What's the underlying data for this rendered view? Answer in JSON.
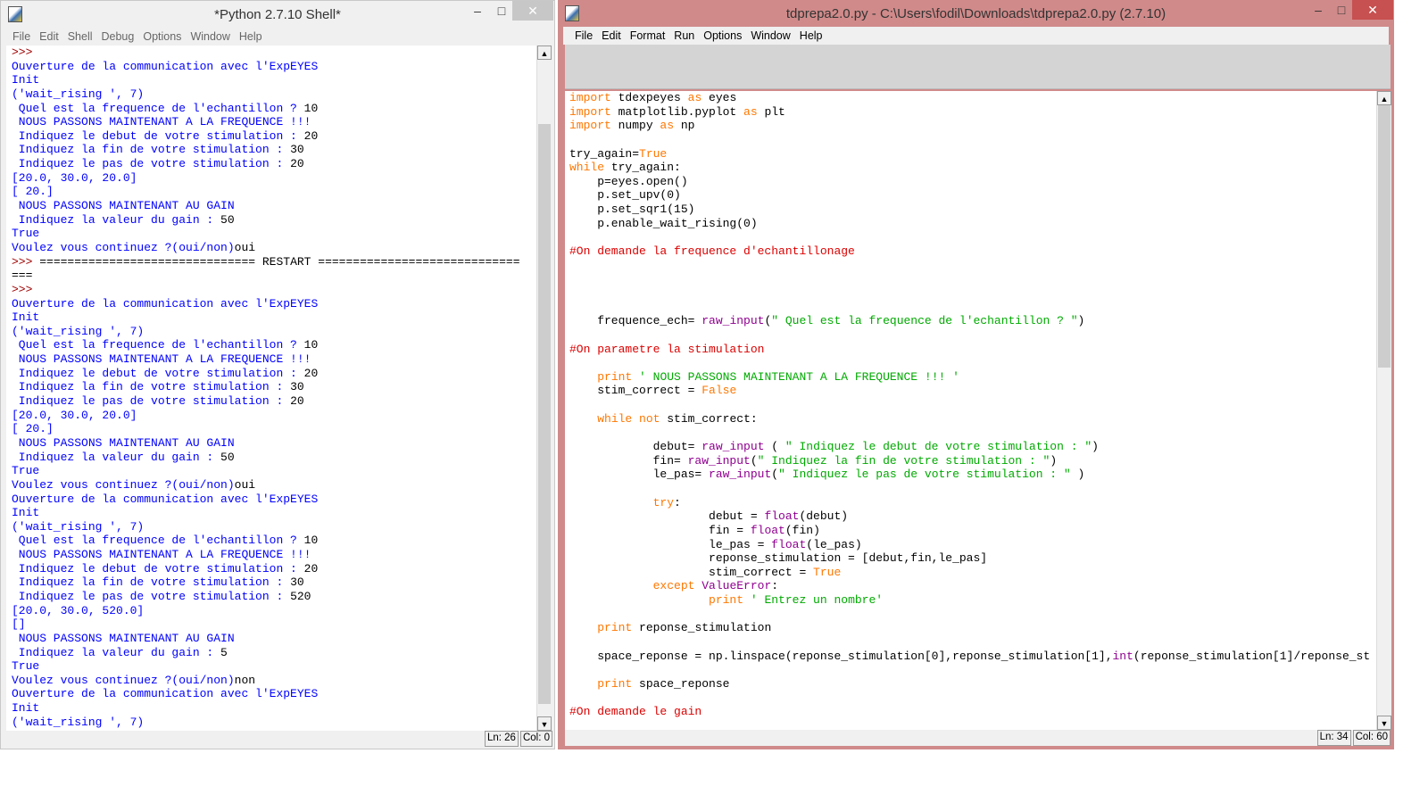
{
  "shell": {
    "title": "*Python 2.7.10 Shell*",
    "menu": [
      "File",
      "Edit",
      "Shell",
      "Debug",
      "Options",
      "Window",
      "Help"
    ],
    "status": {
      "ln": "Ln: 26",
      "col": "Col: 0"
    },
    "lines": [
      [
        [
          ">>> ",
          "pr"
        ]
      ],
      [
        [
          "Ouverture de la communication avec l'ExpEYES",
          "out"
        ]
      ],
      [
        [
          "Init",
          "out"
        ]
      ],
      [
        [
          "('wait_rising ', 7)",
          "out"
        ]
      ],
      [
        [
          " Quel est la frequence de l'echantillon ? ",
          "out"
        ],
        [
          "10",
          "in"
        ]
      ],
      [
        [
          " NOUS PASSONS MAINTENANT A LA FREQUENCE !!!",
          "out"
        ]
      ],
      [
        [
          " Indiquez le debut de votre stimulation : ",
          "out"
        ],
        [
          "20",
          "in"
        ]
      ],
      [
        [
          " Indiquez la fin de votre stimulation : ",
          "out"
        ],
        [
          "30",
          "in"
        ]
      ],
      [
        [
          " Indiquez le pas de votre stimulation : ",
          "out"
        ],
        [
          "20",
          "in"
        ]
      ],
      [
        [
          "[20.0, 30.0, 20.0]",
          "out"
        ]
      ],
      [
        [
          "[ 20.]",
          "out"
        ]
      ],
      [
        [
          " NOUS PASSONS MAINTENANT AU GAIN",
          "out"
        ]
      ],
      [
        [
          " Indiquez la valeur du gain : ",
          "out"
        ],
        [
          "50",
          "in"
        ]
      ],
      [
        [
          "True",
          "out"
        ]
      ],
      [
        [
          "Voulez vous continuez ?(oui/non)",
          "out"
        ],
        [
          "oui",
          "in"
        ]
      ],
      [
        [
          ">>> ",
          "pr"
        ],
        [
          "=============================== RESTART =============================",
          "in"
        ]
      ],
      [
        [
          "===",
          "in"
        ]
      ],
      [
        [
          ">>> ",
          "pr"
        ]
      ],
      [
        [
          "Ouverture de la communication avec l'ExpEYES",
          "out"
        ]
      ],
      [
        [
          "Init",
          "out"
        ]
      ],
      [
        [
          "('wait_rising ', 7)",
          "out"
        ]
      ],
      [
        [
          " Quel est la frequence de l'echantillon ? ",
          "out"
        ],
        [
          "10",
          "in"
        ]
      ],
      [
        [
          " NOUS PASSONS MAINTENANT A LA FREQUENCE !!!",
          "out"
        ]
      ],
      [
        [
          " Indiquez le debut de votre stimulation : ",
          "out"
        ],
        [
          "20",
          "in"
        ]
      ],
      [
        [
          " Indiquez la fin de votre stimulation : ",
          "out"
        ],
        [
          "30",
          "in"
        ]
      ],
      [
        [
          " Indiquez le pas de votre stimulation : ",
          "out"
        ],
        [
          "20",
          "in"
        ]
      ],
      [
        [
          "[20.0, 30.0, 20.0]",
          "out"
        ]
      ],
      [
        [
          "[ 20.]",
          "out"
        ]
      ],
      [
        [
          " NOUS PASSONS MAINTENANT AU GAIN",
          "out"
        ]
      ],
      [
        [
          " Indiquez la valeur du gain : ",
          "out"
        ],
        [
          "50",
          "in"
        ]
      ],
      [
        [
          "True",
          "out"
        ]
      ],
      [
        [
          "Voulez vous continuez ?(oui/non)",
          "out"
        ],
        [
          "oui",
          "in"
        ]
      ],
      [
        [
          "Ouverture de la communication avec l'ExpEYES",
          "out"
        ]
      ],
      [
        [
          "Init",
          "out"
        ]
      ],
      [
        [
          "('wait_rising ', 7)",
          "out"
        ]
      ],
      [
        [
          " Quel est la frequence de l'echantillon ? ",
          "out"
        ],
        [
          "10",
          "in"
        ]
      ],
      [
        [
          " NOUS PASSONS MAINTENANT A LA FREQUENCE !!!",
          "out"
        ]
      ],
      [
        [
          " Indiquez le debut de votre stimulation : ",
          "out"
        ],
        [
          "20",
          "in"
        ]
      ],
      [
        [
          " Indiquez la fin de votre stimulation : ",
          "out"
        ],
        [
          "30",
          "in"
        ]
      ],
      [
        [
          " Indiquez le pas de votre stimulation : ",
          "out"
        ],
        [
          "520",
          "in"
        ]
      ],
      [
        [
          "[20.0, 30.0, 520.0]",
          "out"
        ]
      ],
      [
        [
          "[]",
          "out"
        ]
      ],
      [
        [
          " NOUS PASSONS MAINTENANT AU GAIN",
          "out"
        ]
      ],
      [
        [
          " Indiquez la valeur du gain : ",
          "out"
        ],
        [
          "5",
          "in"
        ]
      ],
      [
        [
          "True",
          "out"
        ]
      ],
      [
        [
          "Voulez vous continuez ?(oui/non)",
          "out"
        ],
        [
          "non",
          "in"
        ]
      ],
      [
        [
          "Ouverture de la communication avec l'ExpEYES",
          "out"
        ]
      ],
      [
        [
          "Init",
          "out"
        ]
      ],
      [
        [
          "('wait_rising ', 7)",
          "out"
        ]
      ]
    ]
  },
  "editor": {
    "title": "tdprepa2.0.py - C:\\Users\\fodil\\Downloads\\tdprepa2.0.py (2.7.10)",
    "menu": [
      "File",
      "Edit",
      "Format",
      "Run",
      "Options",
      "Window",
      "Help"
    ],
    "status": {
      "ln": "Ln: 34",
      "col": "Col: 60"
    },
    "lines": [
      [
        [
          "import",
          "kw"
        ],
        [
          " tdexpeyes ",
          "df"
        ],
        [
          "as",
          "kw"
        ],
        [
          " eyes",
          "df"
        ]
      ],
      [
        [
          "import",
          "kw"
        ],
        [
          " matplotlib.pyplot ",
          "df"
        ],
        [
          "as",
          "kw"
        ],
        [
          " plt",
          "df"
        ]
      ],
      [
        [
          "import",
          "kw"
        ],
        [
          " numpy ",
          "df"
        ],
        [
          "as",
          "kw"
        ],
        [
          " np",
          "df"
        ]
      ],
      [],
      [
        [
          "try_again=",
          "df"
        ],
        [
          "True",
          "kw"
        ]
      ],
      [
        [
          "while",
          "kw"
        ],
        [
          " try_again:",
          "df"
        ]
      ],
      [
        [
          "    p=eyes.open()",
          "df"
        ]
      ],
      [
        [
          "    p.set_upv(0)",
          "df"
        ]
      ],
      [
        [
          "    p.set_sqr1(15)",
          "df"
        ]
      ],
      [
        [
          "    p.enable_wait_rising(0)",
          "df"
        ]
      ],
      [],
      [
        [
          "#On demande la frequence d'echantillonage",
          "cm"
        ]
      ],
      [],
      [],
      [],
      [],
      [
        [
          "    frequence_ech= ",
          "df"
        ],
        [
          "raw_input",
          "bi"
        ],
        [
          "(",
          "df"
        ],
        [
          "\" Quel est la frequence de l'echantillon ? \"",
          "st"
        ],
        [
          ")",
          "df"
        ]
      ],
      [],
      [
        [
          "#On parametre la stimulation",
          "cm"
        ]
      ],
      [],
      [
        [
          "    ",
          "df"
        ],
        [
          "print",
          "kw"
        ],
        [
          " ' NOUS PASSONS MAINTENANT A LA FREQUENCE !!! '",
          "st"
        ]
      ],
      [
        [
          "    stim_correct = ",
          "df"
        ],
        [
          "False",
          "kw"
        ]
      ],
      [],
      [
        [
          "    ",
          "df"
        ],
        [
          "while",
          "kw"
        ],
        [
          " ",
          "df"
        ],
        [
          "not",
          "kw"
        ],
        [
          " stim_correct:",
          "df"
        ]
      ],
      [],
      [
        [
          "            debut= ",
          "df"
        ],
        [
          "raw_input",
          "bi"
        ],
        [
          " ( ",
          "df"
        ],
        [
          "\" Indiquez le debut de votre stimulation : \"",
          "st"
        ],
        [
          ")",
          "df"
        ]
      ],
      [
        [
          "            fin= ",
          "df"
        ],
        [
          "raw_input",
          "bi"
        ],
        [
          "(",
          "df"
        ],
        [
          "\" Indiquez la fin de votre stimulation : \"",
          "st"
        ],
        [
          ")",
          "df"
        ]
      ],
      [
        [
          "            le_pas= ",
          "df"
        ],
        [
          "raw_input",
          "bi"
        ],
        [
          "(",
          "df"
        ],
        [
          "\" Indiquez le pas de votre stimulation : \"",
          "st"
        ],
        [
          " )",
          "df"
        ]
      ],
      [],
      [
        [
          "            ",
          "df"
        ],
        [
          "try",
          "kw"
        ],
        [
          ":",
          "df"
        ]
      ],
      [
        [
          "                    debut = ",
          "df"
        ],
        [
          "float",
          "bi"
        ],
        [
          "(debut)",
          "df"
        ]
      ],
      [
        [
          "                    fin = ",
          "df"
        ],
        [
          "float",
          "bi"
        ],
        [
          "(fin)",
          "df"
        ]
      ],
      [
        [
          "                    le_pas = ",
          "df"
        ],
        [
          "float",
          "bi"
        ],
        [
          "(le_pas)",
          "df"
        ]
      ],
      [
        [
          "                    reponse_stimulation = [debut,fin,le_pas]",
          "df"
        ]
      ],
      [
        [
          "                    stim_correct = ",
          "df"
        ],
        [
          "True",
          "kw"
        ]
      ],
      [
        [
          "            ",
          "df"
        ],
        [
          "except",
          "kw"
        ],
        [
          " ",
          "df"
        ],
        [
          "ValueError",
          "bi"
        ],
        [
          ":",
          "df"
        ]
      ],
      [
        [
          "                    ",
          "df"
        ],
        [
          "print",
          "kw"
        ],
        [
          " ' Entrez un nombre'",
          "st"
        ]
      ],
      [],
      [
        [
          "    ",
          "df"
        ],
        [
          "print",
          "kw"
        ],
        [
          " reponse_stimulation",
          "df"
        ]
      ],
      [],
      [
        [
          "    space_reponse = np.linspace(reponse_stimulation[0],reponse_stimulation[1],",
          "df"
        ],
        [
          "int",
          "bi"
        ],
        [
          "(reponse_stimulation[1]/reponse_st",
          "df"
        ]
      ],
      [],
      [
        [
          "    ",
          "df"
        ],
        [
          "print",
          "kw"
        ],
        [
          " space_reponse",
          "df"
        ]
      ],
      [],
      [
        [
          "#On demande le gain",
          "cm"
        ]
      ]
    ]
  }
}
